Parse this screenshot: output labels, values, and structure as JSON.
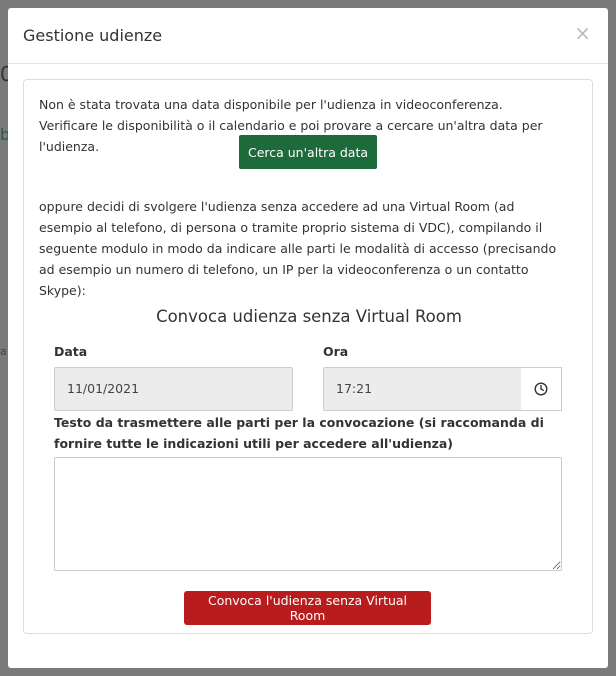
{
  "background": {
    "fragment_top": "0",
    "fragment_mid": "b",
    "fragment_low": "a"
  },
  "modal": {
    "title": "Gestione udienze",
    "close_symbol": "×"
  },
  "content": {
    "not_found_message": "Non è stata trovata una data disponibile per l'udienza in videoconferenza. Verificare le disponibilità o il calendario e poi provare a cercare un'altra data per l'udienza.",
    "search_button_label": "Cerca un'altra data",
    "alternative_message": "oppure decidi di svolgere l'udienza senza accedere ad una Virtual Room (ad esempio al telefono, di persona o tramite proprio sistema di VDC), compilando il seguente modulo in modo da indicare alle parti le modalità di accesso (precisando ad esempio un numero di telefono, un IP per la videoconferenza o un contatto Skype):",
    "section_title": "Convoca udienza senza Virtual Room"
  },
  "form": {
    "date_label": "Data",
    "date_value": "11/01/2021",
    "time_label": "Ora",
    "time_value": "17:21",
    "time_icon": "clock-icon",
    "text_label": "Testo da trasmettere alle parti per la convocazione (si raccomanda di fornire tutte le indicazioni utili per accedere all'udienza)",
    "text_value": "",
    "submit_label": "Convoca l'udienza senza Virtual Room"
  },
  "colors": {
    "green_button": "#1d6b3a",
    "red_button": "#b81c1c",
    "overlay": "#6e6e6e"
  }
}
